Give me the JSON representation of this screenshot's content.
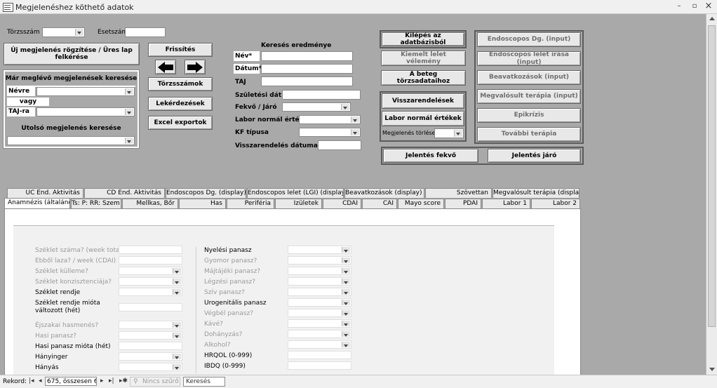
{
  "window": {
    "title": "Megjelenéshez köthető adatok",
    "minimize": "–",
    "maximize": "▫",
    "close": "×"
  },
  "header": {
    "torzsszam_label": "Törzsszám",
    "esetszam_label": "Esetszám",
    "new_visit_button": "Új megjelenés rögzítése / Üres lap felkérése",
    "refresh_button": "Frissítés",
    "torzsszamok_button": "Törzsszámok",
    "lekerdezesek_button": "Lekérdezések",
    "excel_button": "Excel exportok"
  },
  "existing_search": {
    "title": "Már meglévő megjelenések keresése",
    "by_name_label": "Névre",
    "or_label": "vagy",
    "by_taj_label": "TAJ-ra",
    "last_title": "Utolsó megjelenés keresése"
  },
  "search_result": {
    "title": "Keresés eredménye",
    "nev": "Név*",
    "datum": "Dátum*",
    "taj": "TAJ",
    "szuletesi": "Születési dát.",
    "fekvo_jaro": "Fekvő / Járó",
    "labor": "Labor normál érték",
    "kf": "KF típusa",
    "visszarendeles": "Visszarendelés dátuma"
  },
  "actions": {
    "exit": "Kilépés az adatbázisból",
    "kiemelt": "Kiemelt lelet vélemény",
    "torzsadat": "A beteg törzsadataihoz",
    "visszarendelesek": "Visszarendelések",
    "labor_normal": "Labor normál értékek",
    "torles": "Megjelenés törlése",
    "endo_dg": "Endoscopos Dg. (input)",
    "endo_lelet": "Endoscopos lelet írása (input)",
    "beavatkozasok": "Beavatkozások (input)",
    "terapia": "Megvalósult terápia (input)",
    "epikrizis": "Epikrízis",
    "tovabbi": "További terápia",
    "jelentes_fekvo": "Jelentés fekvő",
    "jelentes_jaro": "Jelentés járó"
  },
  "tabs_row1": [
    "UC End. Aktivitás",
    "CD End. Aktivitás",
    "Endoscopos Dg. (display)",
    "Endoscopos lelet (LGI) (display)",
    "Beavatkozások (display)",
    "Szövettan",
    "Megvalósult terápia (display)"
  ],
  "tabs_row2": [
    "Anamnézis (általános)",
    "Ts: P: RR: Szem",
    "Mellkas, Bőr",
    "Has",
    "Periféria",
    "Izületek",
    "CDAI",
    "CAI",
    "Mayo score",
    "PDAI",
    "Labor 1",
    "Labor 2"
  ],
  "form_left": [
    "Széklet száma? (week total)",
    "Ebből laza? / week (CDAI)",
    "Széklet külleme?",
    "Széklet konzisztenciája?",
    "Széklet rendje",
    "Széklet rendje mióta változott (hét)",
    "Éjszakai hasmenés?",
    "Hasi panasz?",
    "Hasi panasz mióta (hét)",
    "Hányinger",
    "Hányás"
  ],
  "form_right": [
    "Nyelési panasz",
    "Gyomor panasz?",
    "Májtájéki panasz?",
    "Légzési panasz?",
    "Szív panasz?",
    "Urogenitális panasz",
    "Végbél panasz?",
    "Kávé?",
    "Dohányzás?",
    "Alkohol?",
    "HRQOL (0-999)",
    "IBDQ (0-999)"
  ],
  "statusbar": {
    "record_label": "Rekord:",
    "record_value": "675, összesen 675",
    "filter": "Nincs szűrő",
    "search": "Keresés"
  }
}
